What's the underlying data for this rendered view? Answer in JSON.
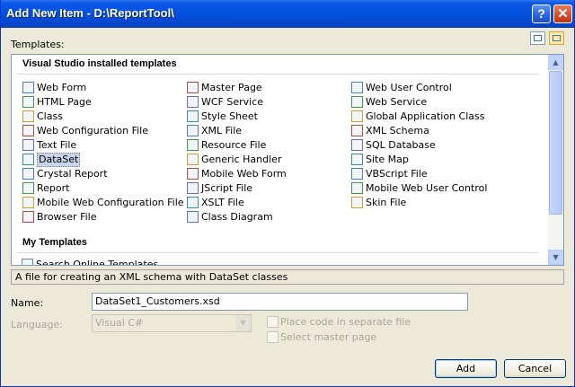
{
  "window": {
    "title": "Add New Item - D:\\ReportTool\\"
  },
  "titlebar": {
    "help_glyph": "?",
    "close_glyph": "✕"
  },
  "templates_label": "Templates:",
  "view_modes": [
    "large-icons-view",
    "small-icons-view"
  ],
  "groups": {
    "installed": "Visual Studio installed templates",
    "my": "My Templates"
  },
  "templates": {
    "col1": [
      "Web Form",
      "HTML Page",
      "Class",
      "Web Configuration File",
      "Text File",
      "DataSet",
      "Crystal Report",
      "Report",
      "Mobile Web Configuration File",
      "Browser File"
    ],
    "col2": [
      "Master Page",
      "WCF Service",
      "Style Sheet",
      "XML File",
      "Resource File",
      "Generic Handler",
      "Mobile Web Form",
      "JScript File",
      "XSLT File",
      "Class Diagram"
    ],
    "col3": [
      "Web User Control",
      "Web Service",
      "Global Application Class",
      "XML Schema",
      "SQL Database",
      "Site Map",
      "VBScript File",
      "Mobile Web User Control",
      "Skin File"
    ],
    "my": [
      "Search Online Templates..."
    ]
  },
  "selected_template": "DataSet",
  "description": "A file for creating an XML schema with DataSet classes",
  "form": {
    "name_label": "Name:",
    "name_value": "DataSet1_Customers.xsd",
    "language_label": "Language:",
    "language_value": "Visual C#",
    "separate_file_label": "Place code in separate file",
    "master_page_label": "Select master page"
  },
  "buttons": {
    "add": "Add",
    "cancel": "Cancel"
  },
  "colors": {
    "titlebar": "#0550de",
    "selection": "#c7d5ea",
    "window": "#ece9d8"
  }
}
